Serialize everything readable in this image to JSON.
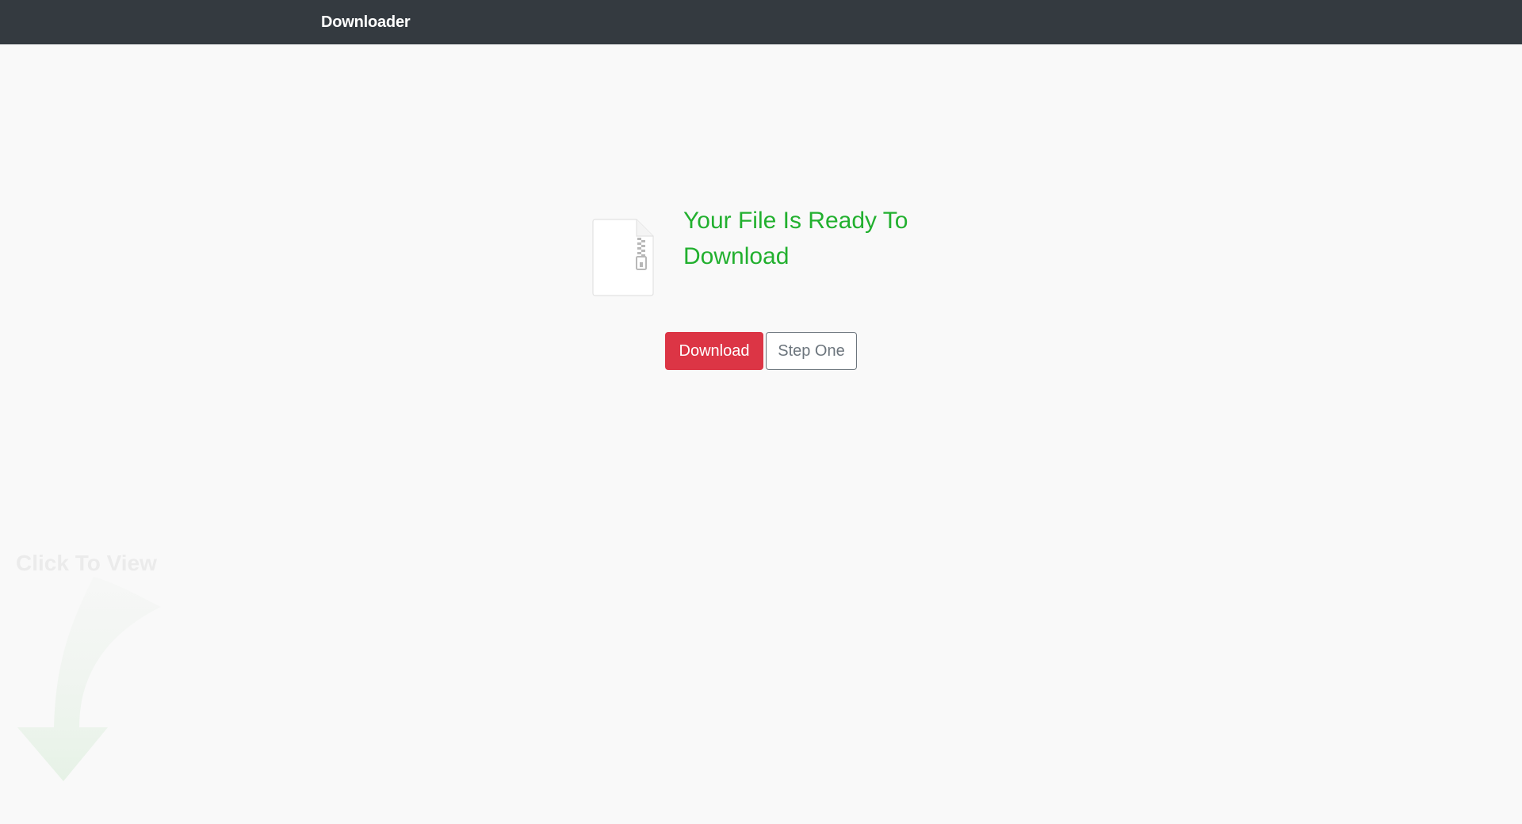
{
  "navbar": {
    "brand": "Downloader",
    "background": "#343a40"
  },
  "main": {
    "file_icon": "zip-file-icon",
    "headline": "Your File Is Ready To Download",
    "headline_color": "#22b02f",
    "download_button": "Download",
    "download_button_color": "#dc3545",
    "step_button": "Step One"
  },
  "overlay": {
    "label": "Click To View",
    "icon": "curved-arrow-down-icon"
  }
}
